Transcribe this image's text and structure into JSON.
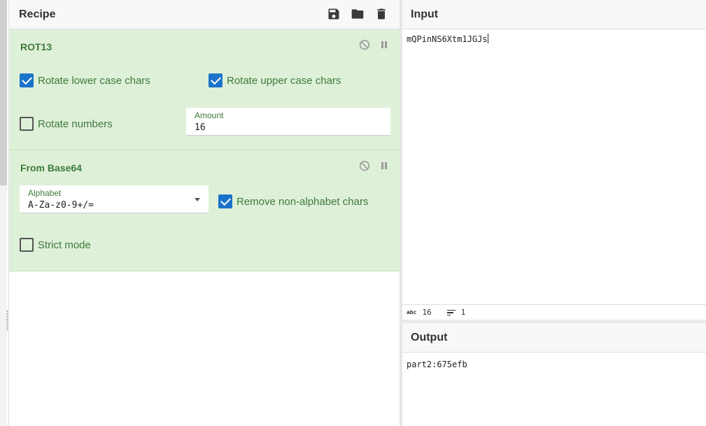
{
  "recipe": {
    "title": "Recipe",
    "tools": [
      "save-icon",
      "folder-icon",
      "trash-icon"
    ]
  },
  "operations": [
    {
      "title": "ROT13",
      "options": {
        "rotate_lower": {
          "label": "Rotate lower case chars",
          "checked": true
        },
        "rotate_upper": {
          "label": "Rotate upper case chars",
          "checked": true
        },
        "rotate_numbers": {
          "label": "Rotate numbers",
          "checked": false
        },
        "amount": {
          "label": "Amount",
          "value": "16"
        }
      }
    },
    {
      "title": "From Base64",
      "options": {
        "alphabet": {
          "label": "Alphabet",
          "value": "A-Za-z0-9+/="
        },
        "remove_non_alphabet": {
          "label": "Remove non-alphabet chars",
          "checked": true
        },
        "strict_mode": {
          "label": "Strict mode",
          "checked": false
        }
      }
    }
  ],
  "input": {
    "title": "Input",
    "value": "mQPinNS6Xtm1JGJs",
    "status": {
      "chars_icon": "abc",
      "chars": "16",
      "lines": "1"
    }
  },
  "output": {
    "title": "Output",
    "value": "part2:675efb"
  },
  "colors": {
    "op_background": "#dff0d8",
    "op_text": "#3c7a3c",
    "checkbox_on": "#1a73c9"
  }
}
